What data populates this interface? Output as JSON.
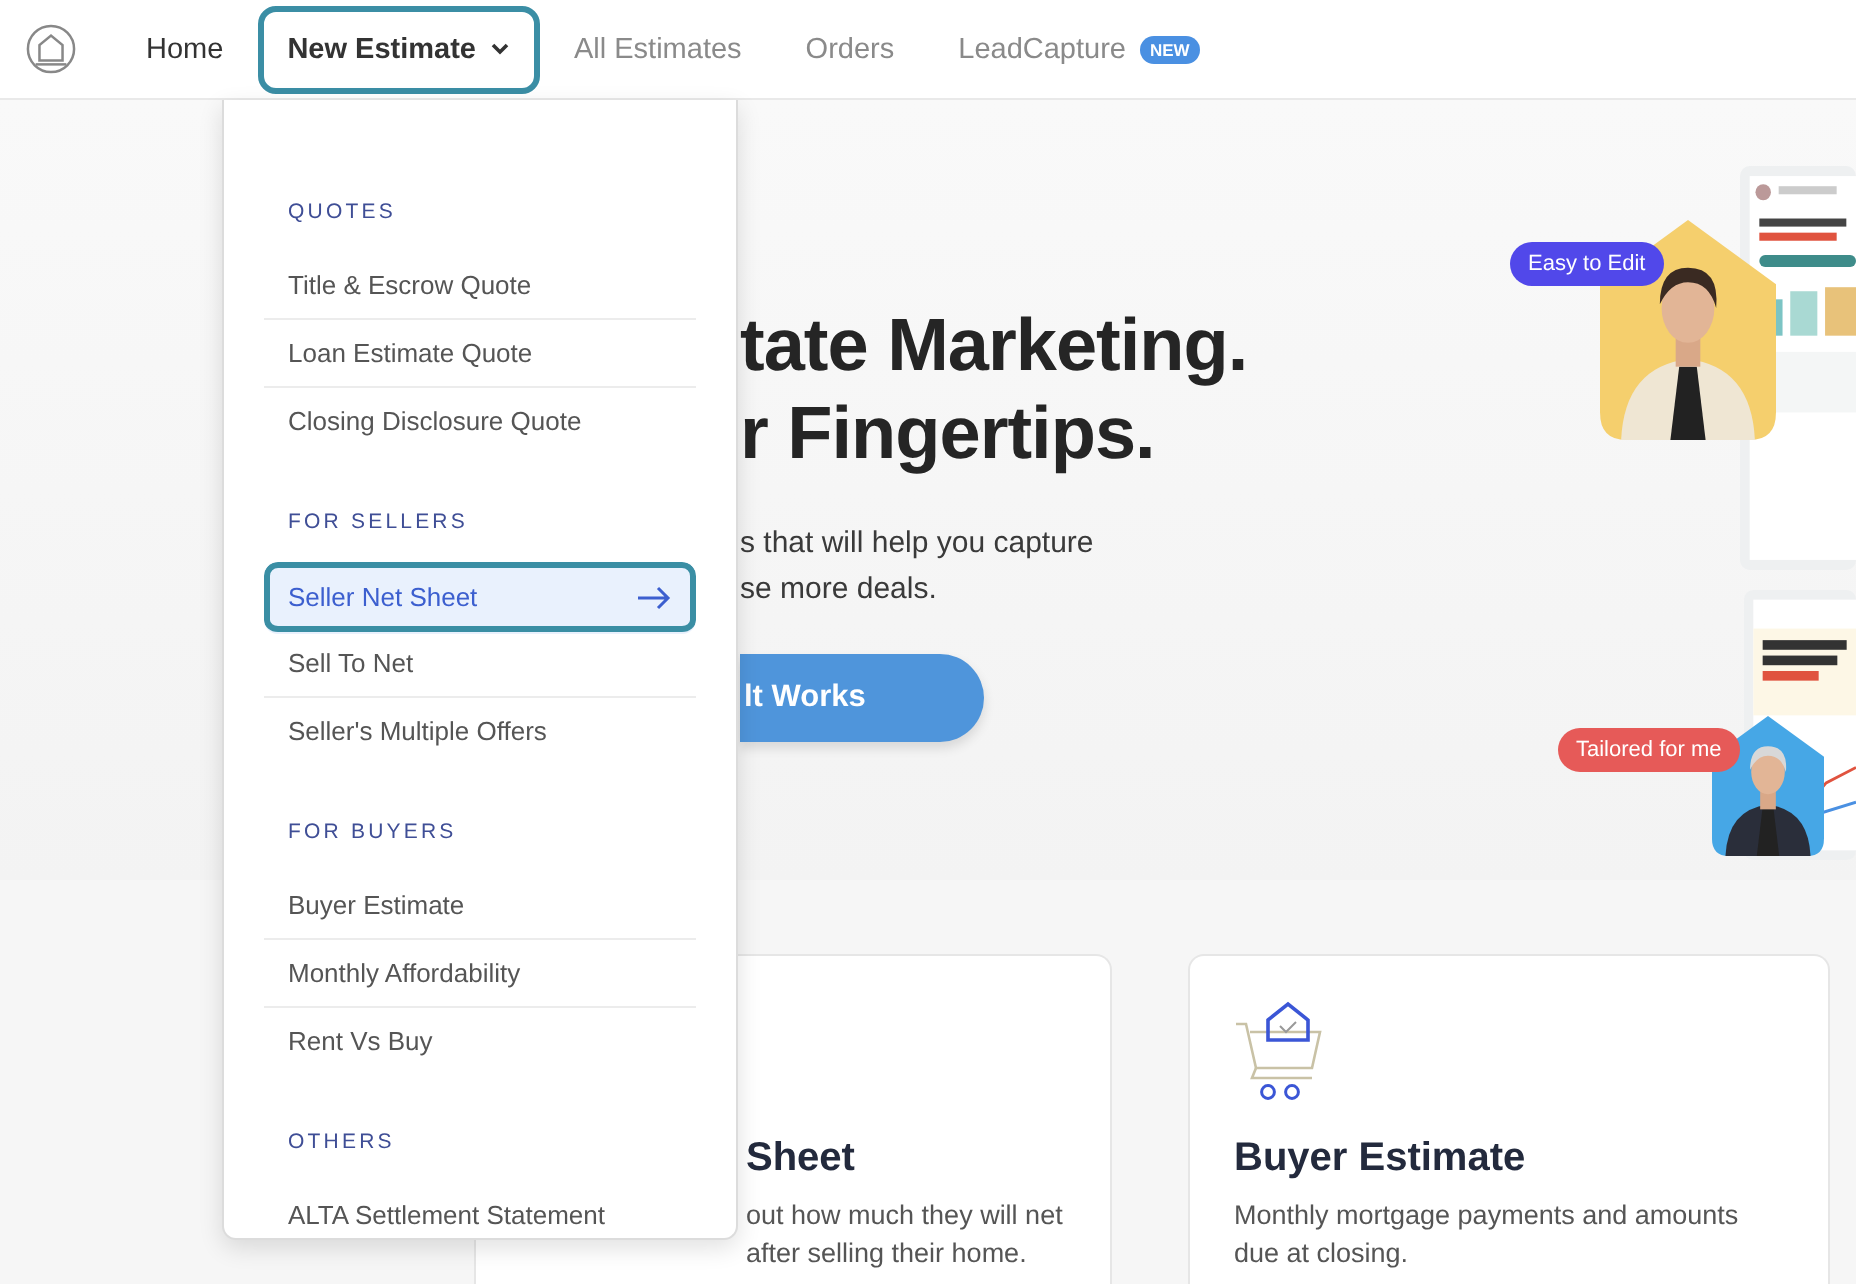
{
  "nav": {
    "items": [
      {
        "label": "Home",
        "selected": false,
        "dimmed": false,
        "dropdown": false
      },
      {
        "label": "New Estimate",
        "selected": true,
        "dimmed": false,
        "dropdown": true
      },
      {
        "label": "All Estimates",
        "selected": false,
        "dimmed": true,
        "dropdown": false
      },
      {
        "label": "Orders",
        "selected": false,
        "dimmed": true,
        "dropdown": false
      },
      {
        "label": "LeadCapture",
        "selected": false,
        "dimmed": true,
        "dropdown": false,
        "badge": "NEW"
      }
    ]
  },
  "menu": {
    "sections": [
      {
        "heading": "QUOTES",
        "items": [
          {
            "label": "Title & Escrow Quote",
            "selected": false
          },
          {
            "label": "Loan Estimate Quote",
            "selected": false
          },
          {
            "label": "Closing Disclosure Quote",
            "selected": false
          }
        ]
      },
      {
        "heading": "FOR SELLERS",
        "items": [
          {
            "label": "Seller Net Sheet",
            "selected": true
          },
          {
            "label": "Sell To Net",
            "selected": false
          },
          {
            "label": "Seller's Multiple Offers",
            "selected": false
          }
        ]
      },
      {
        "heading": "FOR BUYERS",
        "items": [
          {
            "label": "Buyer Estimate",
            "selected": false
          },
          {
            "label": "Monthly Affordability",
            "selected": false
          },
          {
            "label": "Rent Vs Buy",
            "selected": false
          }
        ]
      },
      {
        "heading": "OTHERS",
        "items": [
          {
            "label": "ALTA Settlement Statement",
            "selected": false
          }
        ]
      }
    ]
  },
  "hero": {
    "title_lines": [
      "tate Marketing.",
      "r Fingertips."
    ],
    "subtitle_lines": [
      "s that will help you capture",
      "se more deals."
    ],
    "button": "lt Works",
    "badges": [
      {
        "label": "Easy to Edit",
        "color": "#5148ea"
      },
      {
        "label": "Tailored for me",
        "color": "#e65a58"
      }
    ]
  },
  "cards": [
    {
      "title": "Sheet",
      "icon": false,
      "description_lines": [
        "out how much they will net",
        "after selling their home."
      ]
    },
    {
      "title": "Buyer Estimate",
      "icon": true,
      "description_lines": [
        "Monthly mortgage payments and amounts",
        "due at closing."
      ]
    }
  ]
}
